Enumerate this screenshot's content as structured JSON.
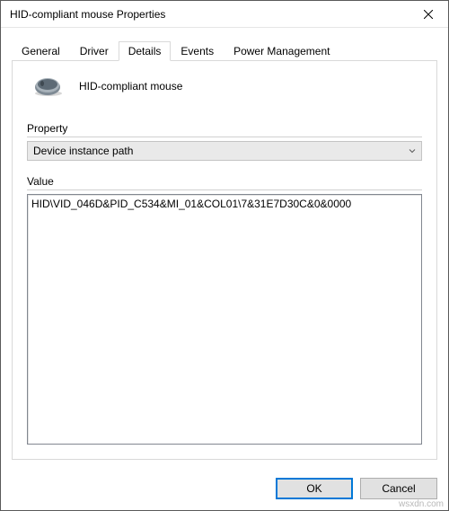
{
  "window": {
    "title": "HID-compliant mouse Properties"
  },
  "tabs": {
    "general": "General",
    "driver": "Driver",
    "details": "Details",
    "events": "Events",
    "power": "Power Management"
  },
  "details": {
    "device_name": "HID-compliant mouse",
    "property_label": "Property",
    "property_selected": "Device instance path",
    "value_label": "Value",
    "value_text": "HID\\VID_046D&PID_C534&MI_01&COL01\\7&31E7D30C&0&0000"
  },
  "buttons": {
    "ok": "OK",
    "cancel": "Cancel"
  },
  "watermark": "wsxdn.com"
}
